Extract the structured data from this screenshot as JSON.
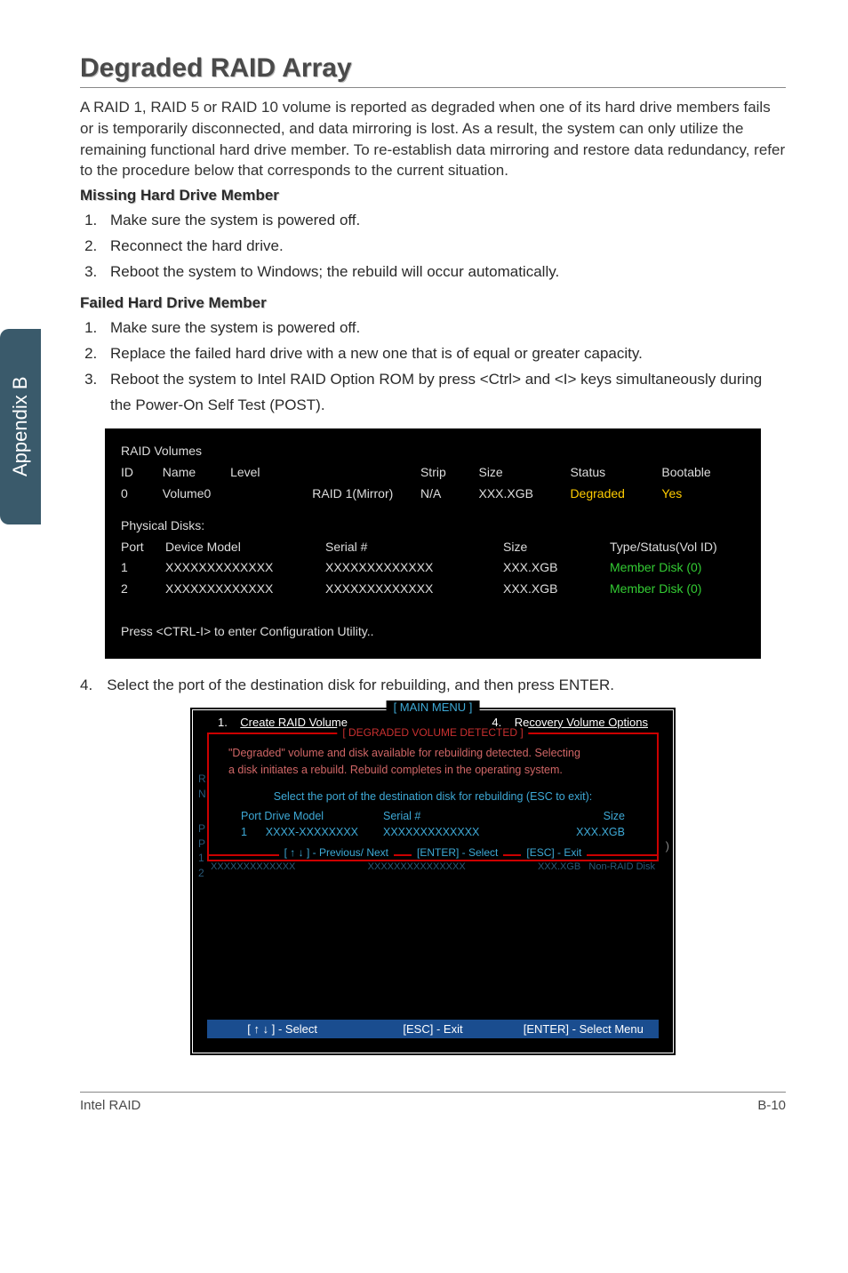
{
  "sidetab": "Appendix B",
  "heading": "Degraded RAID Array",
  "intro": "A RAID 1, RAID 5 or RAID 10 volume is reported as degraded when one of its hard drive members fails or is temporarily disconnected, and data mirroring is lost. As a result, the system can only utilize the remaining functional hard drive member. To re-establish data mirroring and restore data redundancy, refer to the procedure below that corresponds to the current situation.",
  "sub1": "Missing Hard Drive Member",
  "list1": [
    "Make sure the system is powered off.",
    "Reconnect the hard drive.",
    "Reboot the system to Windows; the rebuild will occur automatically."
  ],
  "sub2": "Failed Hard Drive Member",
  "list2": [
    "Make sure the system is powered off.",
    "Replace the failed hard drive with a new one that is of equal or greater capacity.",
    "Reboot the system to Intel RAID Option ROM by press <Ctrl> and <I> keys simultaneously during the Power-On Self Test (POST)."
  ],
  "bios1": {
    "sect1": "RAID Volumes",
    "h": {
      "id": "ID",
      "name": "Name",
      "level": "Level",
      "strip": "Strip",
      "size": "Size",
      "status": "Status",
      "boot": "Bootable"
    },
    "r": {
      "id": "0",
      "name": "Volume0",
      "level": "RAID 1(Mirror)",
      "strip": "N/A",
      "size": "XXX.XGB",
      "status": "Degraded",
      "boot": "Yes"
    },
    "sect2": "Physical Disks:",
    "dh": {
      "port": "Port",
      "model": "Device Model",
      "serial": "Serial #",
      "size": "Size",
      "type": "Type/Status(Vol ID)"
    },
    "rows": [
      {
        "port": "1",
        "model": "XXXXXXXXXXXXX",
        "serial": "XXXXXXXXXXXXX",
        "size": "XXX.XGB",
        "type": "Member  Disk (0)"
      },
      {
        "port": "2",
        "model": "XXXXXXXXXXXXX",
        "serial": "XXXXXXXXXXXXX",
        "size": "XXX.XGB",
        "type": "Member  Disk (0)"
      }
    ],
    "press": "Press  <CTRL-I>  to enter Configuration Utility.."
  },
  "step4num": "4.",
  "step4": "Select the port of the destination disk for rebuilding, and then press ENTER.",
  "bios2": {
    "main_title": "[  MAIN  MENU  ]",
    "opt1num": "1.",
    "opt1": "Create  RAID  Volume",
    "opt4num": "4.",
    "opt4": "Recovery Volume  Options",
    "dialog_title": "[  DEGRADED VOLUME DETECTED  ]",
    "msg1": "\"Degraded\" volume and disk available for rebuilding detected. Selecting",
    "msg2": "a disk initiates a rebuild. Rebuild completes in the  operating system.",
    "prompt": "Select the port of the destination disk for rebuilding (ESC to exit):",
    "dh": {
      "pdm": "Port   Drive   Model",
      "serial": "Serial  #",
      "size": "Size"
    },
    "r": {
      "port": "1",
      "model": "XXXX-XXXXXXXX",
      "serial": "XXXXXXXXXXXXX",
      "size": "XXX.XGB"
    },
    "footer": {
      "a": "[ ↑ ↓ ] - Previous/ Next",
      "b": "[ENTER] - Select",
      "c": "[ESC] - Exit"
    },
    "side": {
      "r": "R",
      "n": "N",
      "p1": "P",
      "p2": "P",
      "one": "1",
      "two": "2",
      "paren": ")"
    },
    "ghost": {
      "left": "XXXXXXXXXXXXX",
      "mid": "XXXXXXXXXXXXXXX",
      "right1": "XXX.XGB",
      "right2": "Non-RAID  Disk"
    }
  },
  "footer_bar": {
    "a": "[ ↑ ↓ ] - Select",
    "b": "[ESC] - Exit",
    "c": "[ENTER] - Select Menu"
  },
  "page_footer": {
    "left": "Intel RAID",
    "right": "B-10"
  }
}
